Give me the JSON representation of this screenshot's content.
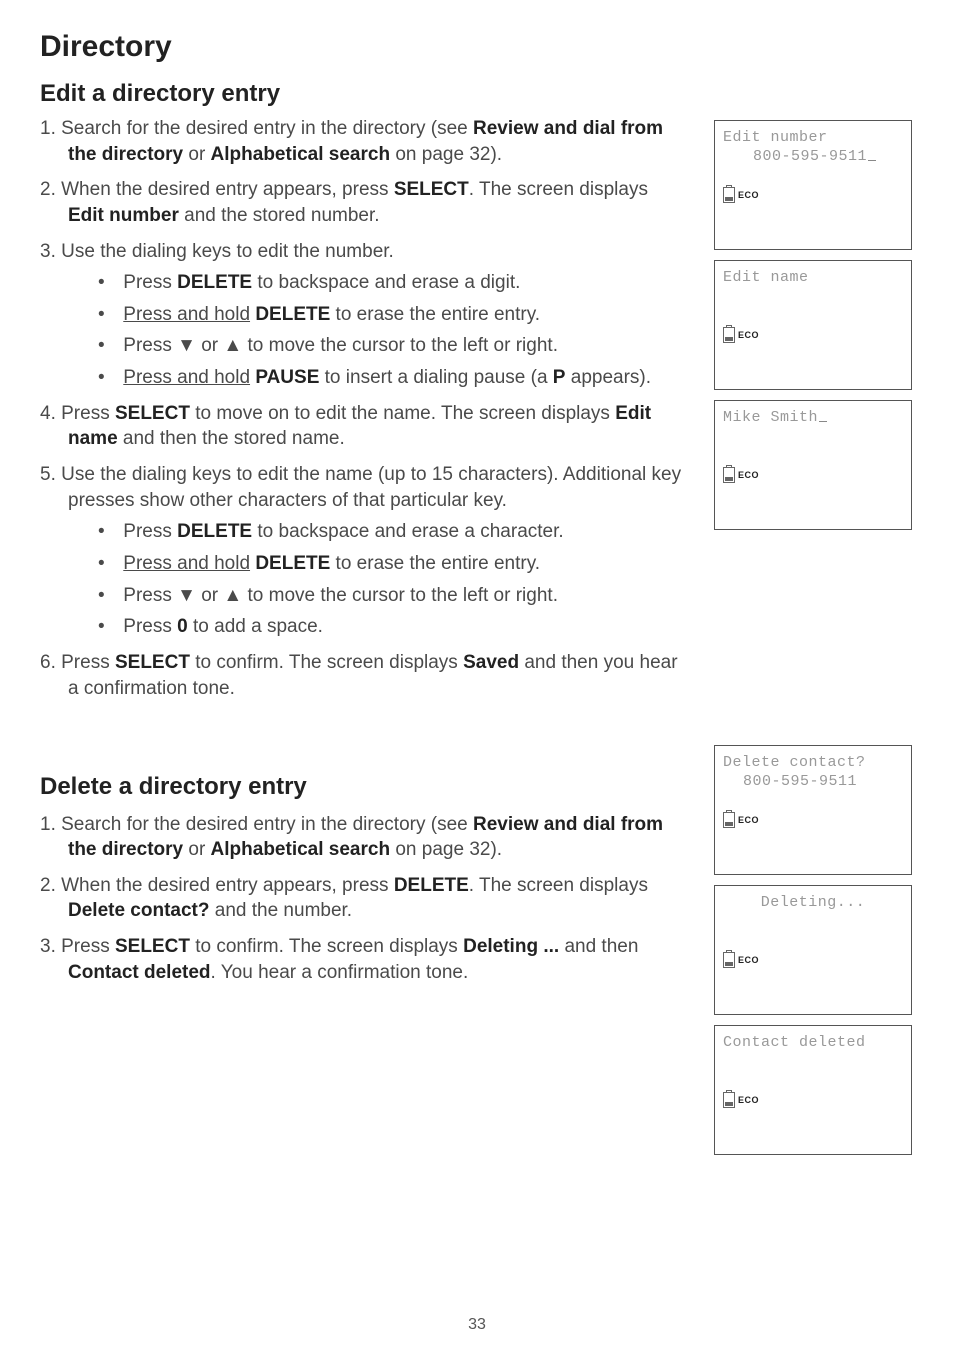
{
  "title": "Directory",
  "edit": {
    "heading": "Edit a directory entry",
    "step1_a": "1.  Search for the desired entry in the directory (see ",
    "step1_b": "Review and dial from the directory",
    "step1_c": " or ",
    "step1_d": "Alphabetical search",
    "step1_e": " on page 32).",
    "step2_a": "2.  When the desired entry appears, press ",
    "step2_b": "SELECT",
    "step2_c": ". The screen displays ",
    "step2_d": "Edit number",
    "step2_e": " and the stored number.",
    "step3": "3.  Use the dialing keys to edit the number.",
    "s3_b1_a": "Press ",
    "s3_b1_b": "DELETE",
    "s3_b1_c": " to backspace and erase a digit.",
    "s3_b2_a": "Press and hold",
    "s3_b2_b": " ",
    "s3_b2_c": "DELETE",
    "s3_b2_d": " to erase the entire entry.",
    "s3_b3_a": "Press ",
    "s3_b3_down": "▼",
    "s3_b3_b": " or ",
    "s3_b3_up": "▲",
    "s3_b3_c": " to move the cursor to the left or right.",
    "s3_b4_a": "Press and hold",
    "s3_b4_b": " ",
    "s3_b4_c": "PAUSE",
    "s3_b4_d": " to insert a dialing pause (a ",
    "s3_b4_e": "P",
    "s3_b4_f": " appears).",
    "step4_a": "4.  Press ",
    "step4_b": "SELECT",
    "step4_c": " to move on to edit the name. The screen displays ",
    "step4_d": "Edit name",
    "step4_e": " and then the stored name.",
    "step5": "5.  Use the dialing keys to edit the name (up to 15 characters). Additional key presses show other characters of that particular key.",
    "s5_b1_a": "Press ",
    "s5_b1_b": "DELETE",
    "s5_b1_c": " to backspace and erase a character.",
    "s5_b2_a": "Press and hold",
    "s5_b2_b": " ",
    "s5_b2_c": "DELETE",
    "s5_b2_d": " to erase the entire entry.",
    "s5_b3_a": "Press ",
    "s5_b3_down": "▼",
    "s5_b3_b": " or ",
    "s5_b3_up": "▲",
    "s5_b3_c": " to move the cursor to the left or right.",
    "s5_b4_a": "Press ",
    "s5_b4_b": "0",
    "s5_b4_c": " to add a space.",
    "step6_a": "6.  Press ",
    "step6_b": "SELECT",
    "step6_c": " to confirm. The screen displays ",
    "step6_d": "Saved",
    "step6_e": " and then you hear a confirmation tone."
  },
  "delete": {
    "heading": "Delete a directory entry",
    "step1_a": "1.  Search for the desired entry in the directory (see ",
    "step1_b": "Review and dial from the directory",
    "step1_c": " or ",
    "step1_d": "Alphabetical search",
    "step1_e": " on page 32).",
    "step2_a": "2.  When the desired entry appears, press ",
    "step2_b": "DELETE",
    "step2_c": ". The screen displays ",
    "step2_d": "Delete contact?",
    "step2_e": " and the number.",
    "step3_a": "3.  Press ",
    "step3_b": "SELECT",
    "step3_c": " to confirm. The screen displays ",
    "step3_d": "Deleting ...",
    "step3_e": " and then ",
    "step3_f": "Contact deleted",
    "step3_g": ". You hear a confirmation tone."
  },
  "lcd": {
    "eco": "ECO",
    "p1_l1": "Edit number",
    "p1_l2": "800-595-9511",
    "p2_l1": "Edit name",
    "p3_l1": "Mike Smith",
    "p4_l1": "Delete contact?",
    "p4_l2": "800-595-9511",
    "p5_l1": "Deleting...",
    "p6_l1": "Contact deleted"
  },
  "pageNumber": "33"
}
